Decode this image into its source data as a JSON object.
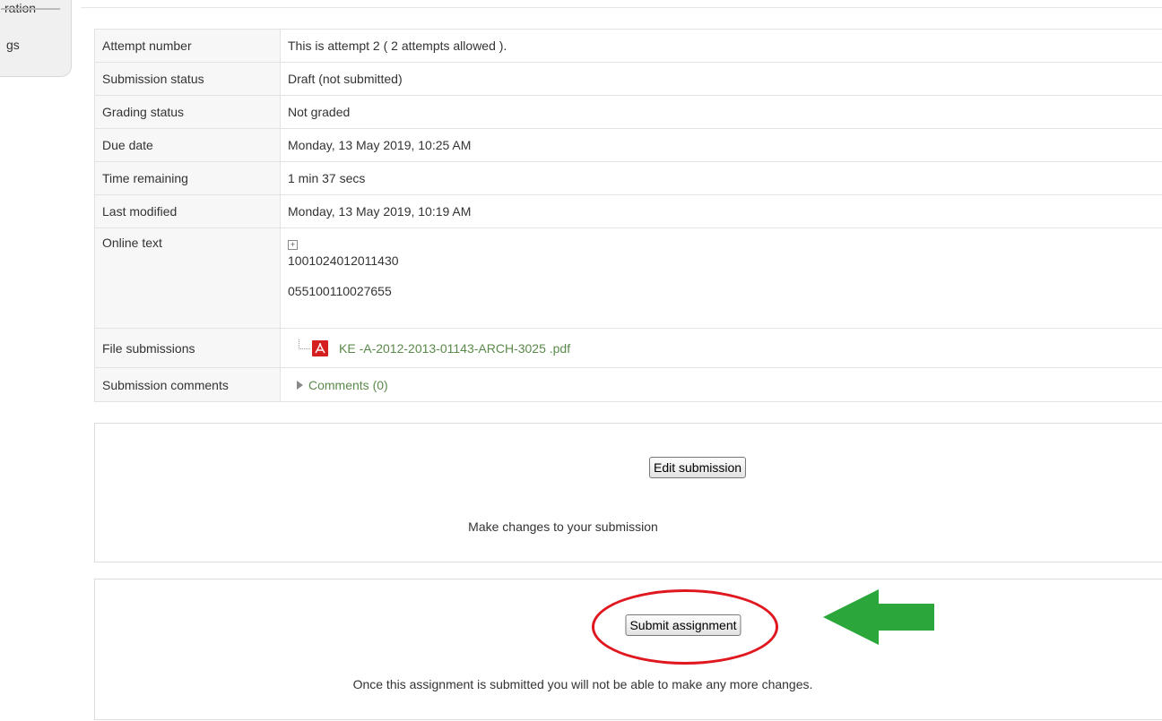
{
  "sidebar": {
    "tab_fragment_top": "ration",
    "tab_fragment": "gs"
  },
  "status_table": [
    {
      "label": "Attempt number",
      "value": "This is attempt 2 ( 2 attempts allowed )."
    },
    {
      "label": "Submission status",
      "value": "Draft (not submitted)"
    },
    {
      "label": "Grading status",
      "value": "Not graded"
    },
    {
      "label": "Due date",
      "value": "Monday, 13 May 2019, 10:25 AM"
    },
    {
      "label": "Time remaining",
      "value": "1 min 37 secs"
    },
    {
      "label": "Last modified",
      "value": "Monday, 13 May 2019, 10:19 AM"
    }
  ],
  "online_text": {
    "label": "Online text",
    "expand_icon": "expand-plus-icon",
    "values": [
      "1001024012011430",
      "055100110027655"
    ]
  },
  "file_submissions": {
    "label": "File submissions",
    "icon": "pdf-icon",
    "file_name": "KE -A-2012-2013-01143-ARCH-3025 .pdf"
  },
  "submission_comments": {
    "label": "Submission comments",
    "link": "Comments (0)"
  },
  "edit_box": {
    "button_label": "Edit submission",
    "description": "Make changes to your submission"
  },
  "submit_box": {
    "button_label": "Submit assignment",
    "description": "Once this assignment is submitted you will not be able to make any more changes."
  },
  "annotations": {
    "circle_color": "#e0171f",
    "arrow_color": "#2aa63a"
  },
  "colors": {
    "link": "#5a8a4a",
    "label_bg": "#f7f7f7",
    "border": "#e3e3e3"
  }
}
